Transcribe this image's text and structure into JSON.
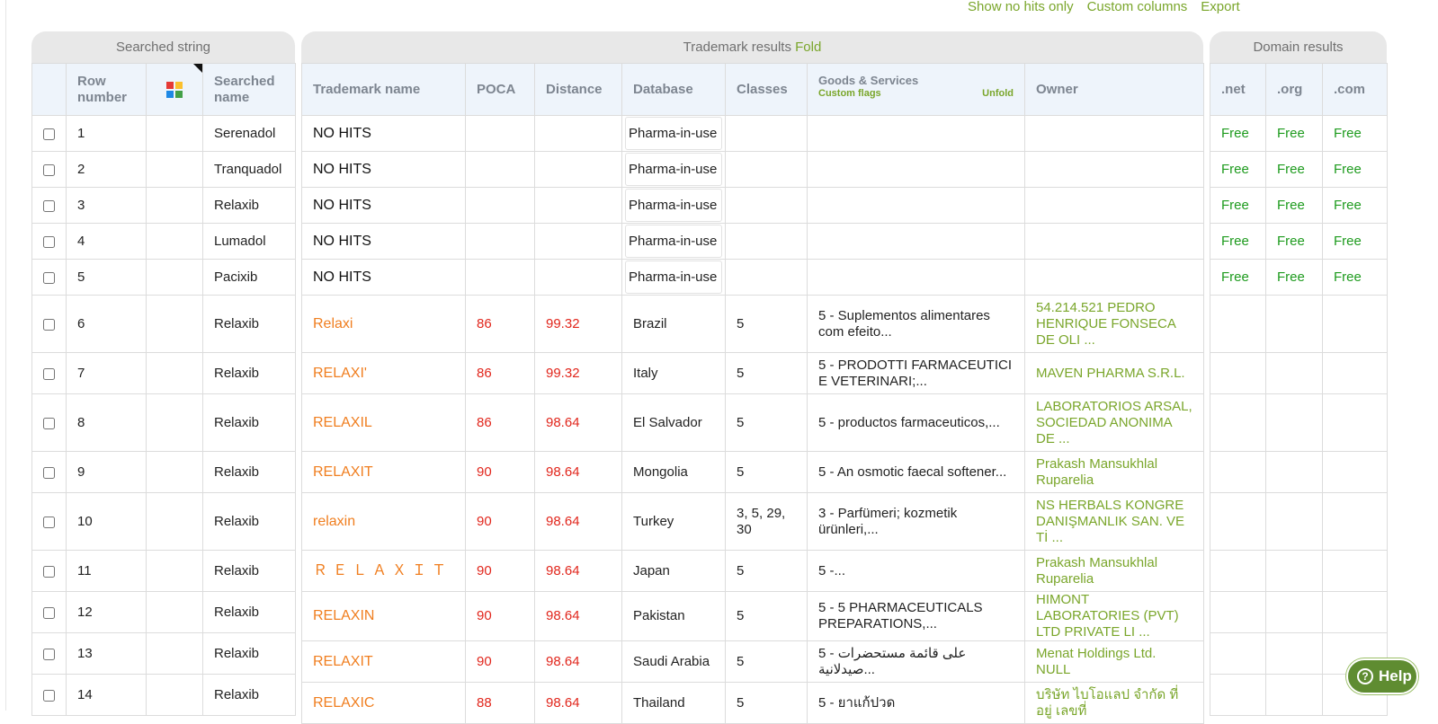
{
  "top_links": {
    "show_no_hits": "Show no hits only",
    "custom_columns": "Custom columns",
    "export": "Export"
  },
  "searched_panel": {
    "title": "Searched string",
    "headers": {
      "row_number": "Row number",
      "searched_name": "Searched name"
    },
    "rows": [
      {
        "row": "1",
        "name": "Serenadol"
      },
      {
        "row": "2",
        "name": "Tranquadol"
      },
      {
        "row": "3",
        "name": "Relaxib"
      },
      {
        "row": "4",
        "name": "Lumadol"
      },
      {
        "row": "5",
        "name": "Pacixib"
      },
      {
        "row": "6",
        "name": "Relaxib"
      },
      {
        "row": "7",
        "name": "Relaxib"
      },
      {
        "row": "8",
        "name": "Relaxib"
      },
      {
        "row": "9",
        "name": "Relaxib"
      },
      {
        "row": "10",
        "name": "Relaxib"
      },
      {
        "row": "11",
        "name": "Relaxib"
      },
      {
        "row": "12",
        "name": "Relaxib"
      },
      {
        "row": "13",
        "name": "Relaxib"
      },
      {
        "row": "14",
        "name": "Relaxib"
      }
    ]
  },
  "trademark_panel": {
    "title": "Trademark results",
    "fold_label": "Fold",
    "headers": {
      "trademark_name": "Trademark name",
      "poca": "POCA",
      "distance": "Distance",
      "database": "Database",
      "classes": "Classes",
      "goods_services": "Goods & Services",
      "custom_flags": "Custom flags",
      "unfold": "Unfold",
      "owner": "Owner"
    },
    "rows": [
      {
        "name": "NO HITS",
        "poca": "",
        "distance": "",
        "database": "Pharma-in-use",
        "classes": "",
        "goods": "",
        "owner": ""
      },
      {
        "name": "NO HITS",
        "poca": "",
        "distance": "",
        "database": "Pharma-in-use",
        "classes": "",
        "goods": "",
        "owner": ""
      },
      {
        "name": "NO HITS",
        "poca": "",
        "distance": "",
        "database": "Pharma-in-use",
        "classes": "",
        "goods": "",
        "owner": ""
      },
      {
        "name": "NO HITS",
        "poca": "",
        "distance": "",
        "database": "Pharma-in-use",
        "classes": "",
        "goods": "",
        "owner": ""
      },
      {
        "name": "NO HITS",
        "poca": "",
        "distance": "",
        "database": "Pharma-in-use",
        "classes": "",
        "goods": "",
        "owner": ""
      },
      {
        "name": "Relaxi",
        "poca": "86",
        "distance": "99.32",
        "database": "Brazil",
        "classes": "5",
        "goods": "5 - Suplementos alimentares com efeito...",
        "owner": "54.214.521 PEDRO HENRIQUE FONSECA DE OLI ..."
      },
      {
        "name": "RELAXI'",
        "poca": "86",
        "distance": "99.32",
        "database": "Italy",
        "classes": "5",
        "goods": "5 - PRODOTTI FARMACEUTICI E VETERINARI;...",
        "owner": "MAVEN PHARMA S.R.L."
      },
      {
        "name": "RELAXIL",
        "poca": "86",
        "distance": "98.64",
        "database": "El Salvador",
        "classes": "5",
        "goods": "5 - productos farmaceuticos,...",
        "owner": "LABORATORIOS ARSAL, SOCIEDAD ANONIMA DE ..."
      },
      {
        "name": "RELAXIT",
        "poca": "90",
        "distance": "98.64",
        "database": "Mongolia",
        "classes": "5",
        "goods": "5 - An osmotic faecal softener...",
        "owner": "Prakash Mansukhlal Ruparelia"
      },
      {
        "name": "relaxin",
        "poca": "90",
        "distance": "98.64",
        "database": "Turkey",
        "classes": "3, 5, 29, 30",
        "goods": "3 - Parfümeri; kozmetik ürünleri,...",
        "owner": "NS HERBALS KONGRE DANIŞMANLIK SAN. VE Tİ ..."
      },
      {
        "name": "ＲＥＬＡＸＩＴ",
        "poca": "90",
        "distance": "98.64",
        "database": "Japan",
        "classes": "5",
        "goods": "5 -...",
        "owner": "Prakash Mansukhlal Ruparelia"
      },
      {
        "name": "RELAXIN",
        "poca": "90",
        "distance": "98.64",
        "database": "Pakistan",
        "classes": "5",
        "goods": "5 - 5 PHARMACEUTICALS PREPARATIONS,...",
        "owner": "HIMONT LABORATORIES (PVT) LTD PRIVATE LI ..."
      },
      {
        "name": "RELAXIT",
        "poca": "90",
        "distance": "98.64",
        "database": "Saudi Arabia",
        "classes": "5",
        "goods": "5 - على قائمة مستحضرات صيدلانية...",
        "owner": "Menat Holdings Ltd. NULL"
      },
      {
        "name": "RELAXIC",
        "poca": "88",
        "distance": "98.64",
        "database": "Thailand",
        "classes": "5",
        "goods": "5 - ยาแก้ปวด",
        "owner": "บริษัท ไบโอแลป จำกัด ที่อยู่ เลขที่"
      }
    ]
  },
  "domain_panel": {
    "title": "Domain results",
    "headers": {
      "net": ".net",
      "org": ".org",
      "com": ".com"
    },
    "rows": [
      {
        "net": "Free",
        "org": "Free",
        "com": "Free"
      },
      {
        "net": "Free",
        "org": "Free",
        "com": "Free"
      },
      {
        "net": "Free",
        "org": "Free",
        "com": "Free"
      },
      {
        "net": "Free",
        "org": "Free",
        "com": "Free"
      },
      {
        "net": "Free",
        "org": "Free",
        "com": "Free"
      },
      {
        "net": "",
        "org": "",
        "com": ""
      },
      {
        "net": "",
        "org": "",
        "com": ""
      },
      {
        "net": "",
        "org": "",
        "com": ""
      },
      {
        "net": "",
        "org": "",
        "com": ""
      },
      {
        "net": "",
        "org": "",
        "com": ""
      },
      {
        "net": "",
        "org": "",
        "com": ""
      },
      {
        "net": "",
        "org": "",
        "com": ""
      },
      {
        "net": "",
        "org": "",
        "com": ""
      },
      {
        "net": "",
        "org": "",
        "com": ""
      }
    ]
  },
  "help_button": {
    "label": "Help",
    "icon": "question-circle-icon"
  },
  "colors": {
    "accent_green": "#7aa62b",
    "trademark_orange": "#f07e1f",
    "score_red": "#e1261c",
    "free_green": "#1e9b1e",
    "header_bg": "#eef4fb",
    "panel_header_bg": "#e8e8e8",
    "help_bg": "#5f8c31"
  }
}
